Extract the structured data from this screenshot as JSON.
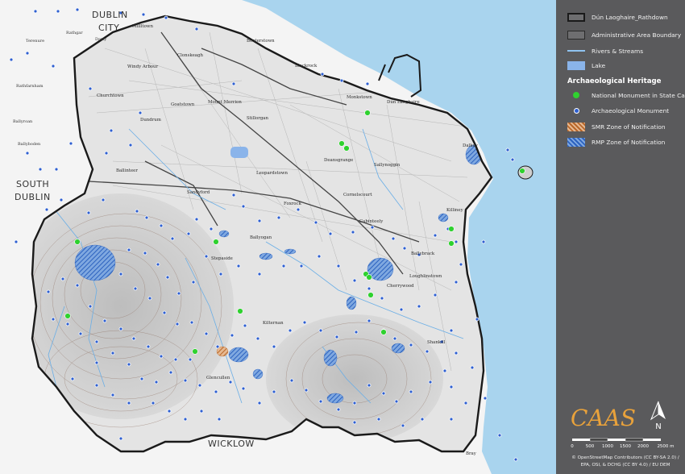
{
  "colors": {
    "sea": "#a9d4ee",
    "land_outside": "#f4f4f4",
    "land_inside": "#e4e4e4",
    "mountain": "#cfcfcf",
    "boundary": "#1a1a1a",
    "river": "#6aaee6",
    "lake": "#8ab4ea",
    "monument_state": "#2fd12f",
    "monument": "#2e5fd0",
    "smr": "#c8813a",
    "rmp": "#3c78c8",
    "contour": "#8a6a5a",
    "panel": "#5a5a5c"
  },
  "regions": [
    {
      "label": "DUBLIN"
    },
    {
      "label": "CITY"
    },
    {
      "label": "SOUTH"
    },
    {
      "label": "DUBLIN"
    },
    {
      "label": "WICKLOW"
    }
  ],
  "places": [
    "Millltown",
    "Booterstown",
    "Clonskeagh",
    "Windy Arbour",
    "Blackrock",
    "Churchtown",
    "Goatstown",
    "Monkstown",
    "Dún Laoghaire",
    "Mount Merrion",
    "Stillorgan",
    "Dundrum",
    "Deansgrange",
    "Sallynoggin",
    "Dalkey",
    "Ballinteer",
    "Leopardstown",
    "Cornelscourt",
    "Killiney",
    "Sandyford",
    "Foxrock",
    "Cabinteely",
    "Ballyogan",
    "Stepaside",
    "Ballybrack",
    "Loughlinstown",
    "Cherrywood",
    "Kilternan",
    "Shankill",
    "Glencullen",
    "Bray",
    "Rathgar",
    "Terenure",
    "Darty",
    "Rathfarnham",
    "Ballyroan",
    "Ballyboden"
  ],
  "legend": {
    "items": [
      {
        "label": "Dún Laoghaire_Rathdown",
        "icon": "boundary-box-dark"
      },
      {
        "label": "Administrative Area Boundary",
        "icon": "boundary-box-grey"
      },
      {
        "label": "Rivers & Streams",
        "icon": "river-line"
      },
      {
        "label": "Lake",
        "icon": "lake-fill"
      }
    ],
    "heading": "Archaeological Heritage",
    "heritage_items": [
      {
        "label": "National Monument in State Care",
        "icon": "green-dot"
      },
      {
        "label": "Archaeological Monument",
        "icon": "blue-dot"
      },
      {
        "label": "SMR Zone of Notification",
        "icon": "orange-hatch"
      },
      {
        "label": "RMP Zone of Notification",
        "icon": "blue-hatch"
      }
    ]
  },
  "logo": {
    "text": "CAAS"
  },
  "north_arrow": {
    "label": "N"
  },
  "scale": {
    "ticks": [
      "0",
      "500",
      "1000",
      "1500",
      "2000",
      "2500 m"
    ]
  },
  "credits": [
    "© OpenStreetMap Contributors (CC BY-SA 2.0) /",
    "EPA, OSI, & DCHG (CC BY 4.0) / EU DEM"
  ]
}
